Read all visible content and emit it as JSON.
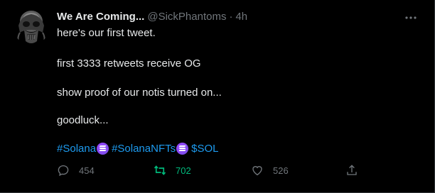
{
  "tweet": {
    "author": {
      "display_name": "We Are Coming...",
      "handle": "@SickPhantoms",
      "separator": "·",
      "time": "4h"
    },
    "body": {
      "line1": "here's our first tweet.",
      "line2": "first 3333 retweets receive OG",
      "line3": "show proof of our notis turned on...",
      "line4": "goodluck..."
    },
    "hashtags": [
      {
        "text": "#Solana",
        "badge": "solana-badge-icon"
      },
      {
        "text": "#SolanaNFTs",
        "badge": "solana-badge-icon"
      },
      {
        "text": "$SOL"
      }
    ],
    "actions": {
      "reply_count": "454",
      "retweet_count": "702",
      "like_count": "526"
    },
    "retweeted": true,
    "icons": {
      "avatar": "phantom-avatar",
      "more": "more-icon",
      "reply": "reply-icon",
      "retweet": "retweet-icon",
      "like": "heart-icon",
      "share": "share-icon"
    },
    "colors": {
      "background": "#000000",
      "text": "#e7e9ea",
      "muted": "#71767b",
      "link": "#1d9bf0",
      "retweet_active": "#00ba7c",
      "solana_badge": "#9945ff"
    }
  }
}
